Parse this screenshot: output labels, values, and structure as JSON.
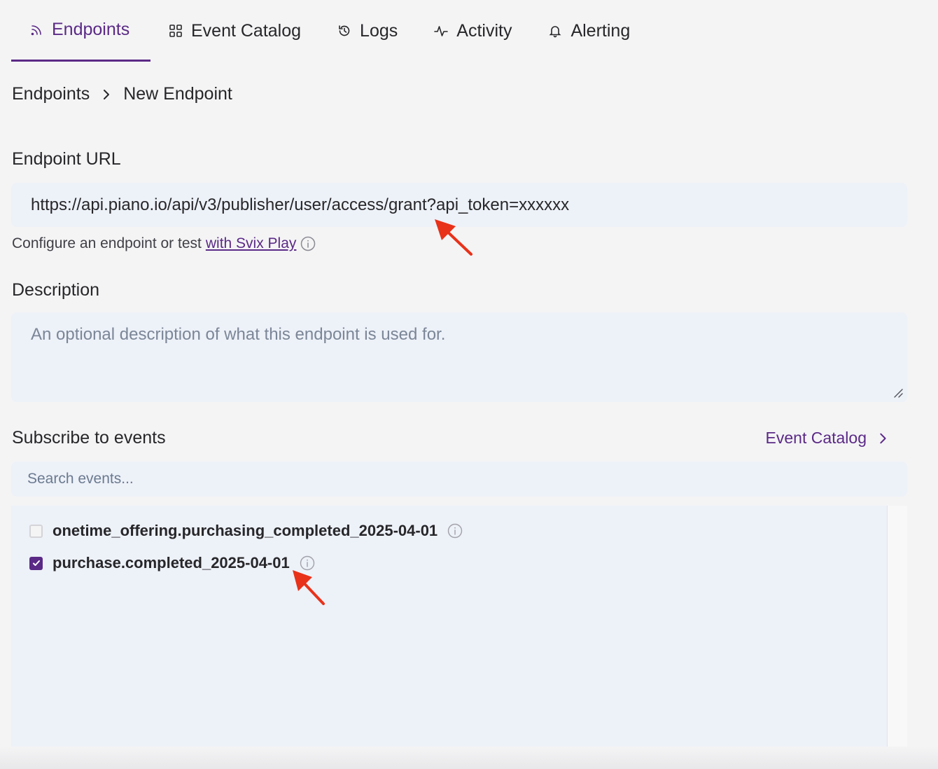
{
  "tabs": [
    {
      "label": "Endpoints",
      "icon": "rss-icon",
      "active": true
    },
    {
      "label": "Event Catalog",
      "icon": "grid-icon",
      "active": false
    },
    {
      "label": "Logs",
      "icon": "history-icon",
      "active": false
    },
    {
      "label": "Activity",
      "icon": "activity-icon",
      "active": false
    },
    {
      "label": "Alerting",
      "icon": "bell-icon",
      "active": false
    }
  ],
  "breadcrumb": {
    "parent": "Endpoints",
    "current": "New Endpoint"
  },
  "endpoint_url": {
    "label": "Endpoint URL",
    "value": "https://api.piano.io/api/v3/publisher/user/access/grant?api_token=xxxxxx",
    "helper_text": "Configure an endpoint or test",
    "helper_link": "with Svix Play"
  },
  "description": {
    "label": "Description",
    "placeholder": "An optional description of what this endpoint is used for."
  },
  "subscribe": {
    "label": "Subscribe to events",
    "catalog_link": "Event Catalog",
    "search_placeholder": "Search events...",
    "events": [
      {
        "name": "onetime_offering.purchasing_completed_2025-04-01",
        "checked": false
      },
      {
        "name": "purchase.completed_2025-04-01",
        "checked": true
      }
    ]
  },
  "colors": {
    "accent": "#5b2a86",
    "field_bg": "#edf1f8",
    "annotation_arrow": "#e8321a"
  }
}
